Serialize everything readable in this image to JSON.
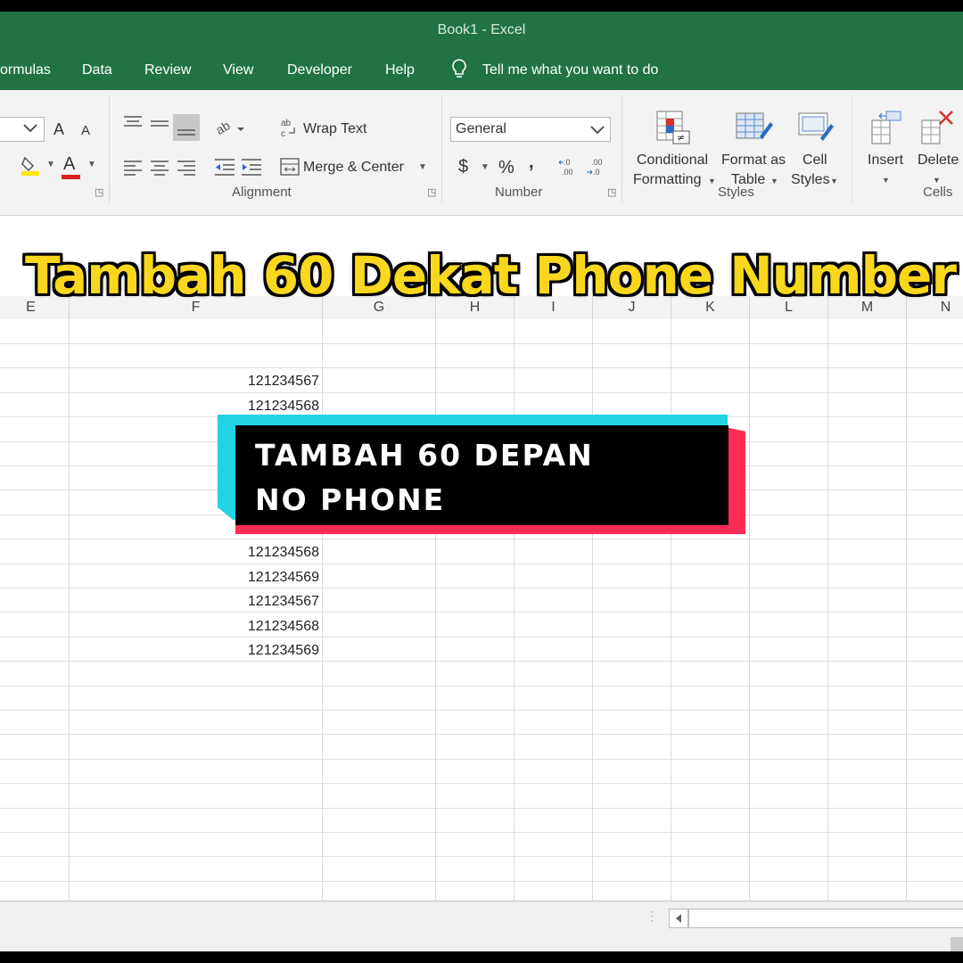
{
  "window": {
    "title": "Book1  -  Excel"
  },
  "menu": {
    "formulas": "ormulas",
    "data": "Data",
    "review": "Review",
    "view": "View",
    "developer": "Developer",
    "help": "Help",
    "tell_me": "Tell me what you want to do"
  },
  "ribbon": {
    "font": {
      "grow": "A",
      "shrink": "A",
      "font_color_letter": "A"
    },
    "alignment": {
      "wrap_text": "Wrap Text",
      "merge_center": "Merge & Center",
      "label": "Alignment"
    },
    "number": {
      "format_value": "General",
      "currency": "$",
      "percent": "%",
      "comma": ",",
      "label": "Number"
    },
    "styles": {
      "conditional_1": "Conditional",
      "conditional_2": "Formatting",
      "format_table_1": "Format as",
      "format_table_2": "Table",
      "cell_styles_1": "Cell",
      "cell_styles_2": "Styles",
      "label": "Styles"
    },
    "cells": {
      "insert": "Insert",
      "delete": "Delete",
      "label": "Cells"
    }
  },
  "columns": [
    "E",
    "F",
    "G",
    "H",
    "I",
    "J",
    "K",
    "L",
    "M",
    "N"
  ],
  "cells_f": [
    {
      "row": 3,
      "value": "121234567"
    },
    {
      "row": 4,
      "value": "121234568"
    },
    {
      "row": 10,
      "value": "121234568"
    },
    {
      "row": 11,
      "value": "121234569"
    },
    {
      "row": 12,
      "value": "121234567"
    },
    {
      "row": 13,
      "value": "121234568"
    },
    {
      "row": 14,
      "value": "121234569"
    }
  ],
  "overlay": {
    "title": "Tambah 60 Dekat Phone Number",
    "banner_line1": "TAMBAH 60 DEPAN",
    "banner_line2": "NO PHONE"
  },
  "colors": {
    "excel_green": "#217346",
    "title_yellow": "#f9d71c",
    "banner_cyan": "#22d3e6",
    "banner_red": "#fe2c55"
  }
}
